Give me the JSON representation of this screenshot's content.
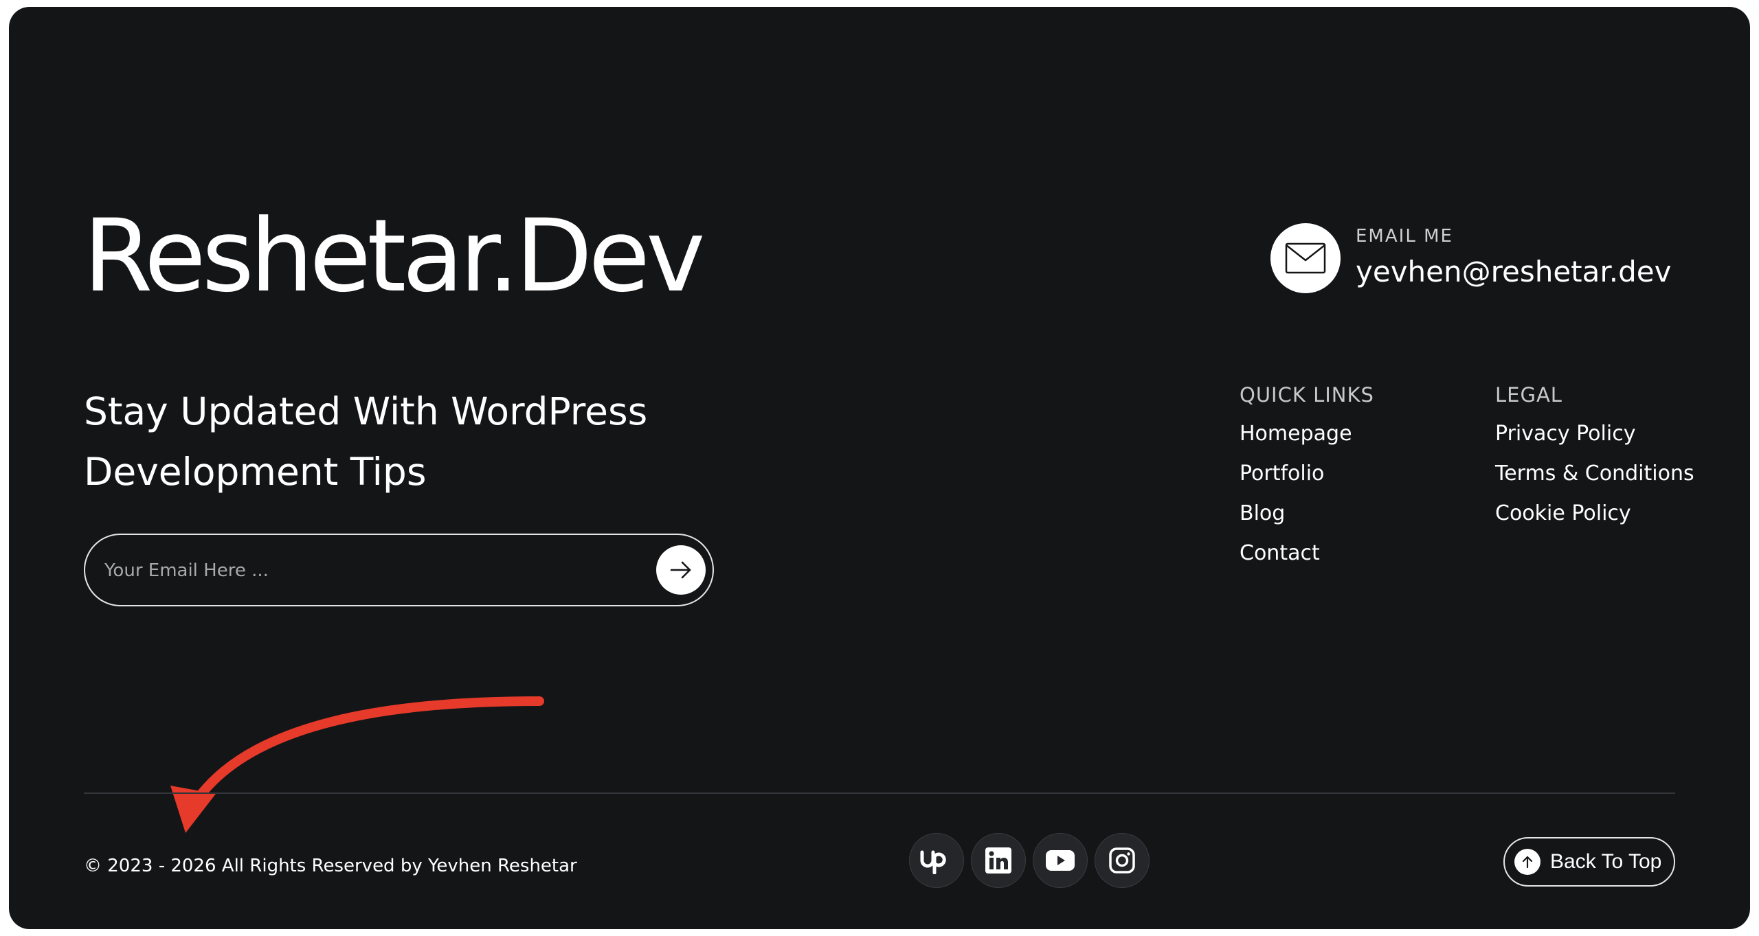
{
  "brand": {
    "logo_text": "Reshetar.Dev"
  },
  "newsletter": {
    "heading_line1": "Stay Updated With WordPress",
    "heading_line2": "Development Tips",
    "input_placeholder": "Your Email Here ...",
    "submit_icon": "arrow-right-icon"
  },
  "contact": {
    "label": "EMAIL ME",
    "email": "yevhen@reshetar.dev",
    "icon": "envelope-icon"
  },
  "quick_links": {
    "title": "QUICK LINKS",
    "items": [
      "Homepage",
      "Portfolio",
      "Blog",
      "Contact"
    ]
  },
  "legal": {
    "title": "LEGAL",
    "items": [
      "Privacy Policy",
      "Terms & Conditions",
      "Cookie Policy"
    ]
  },
  "footer": {
    "copyright": "© 2023 - 2026 All Rights Reserved by Yevhen Reshetar",
    "socials": [
      {
        "name": "upwork-icon"
      },
      {
        "name": "linkedin-icon"
      },
      {
        "name": "youtube-icon"
      },
      {
        "name": "instagram-icon"
      }
    ],
    "back_to_top": "Back To Top"
  },
  "colors": {
    "background": "#141517",
    "text": "#ffffff",
    "annotation_arrow": "#e63a2a"
  }
}
